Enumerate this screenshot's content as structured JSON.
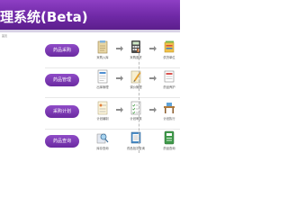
{
  "app": {
    "title": "理系统(Beta)"
  },
  "breadcrumb": "首页",
  "flows": [
    {
      "category": "药品采购",
      "items": [
        "采购入库",
        "采购退货",
        "供货单位"
      ]
    },
    {
      "category": "药品管理",
      "items": [
        "出库管理",
        "调价管理",
        "药品养护"
      ]
    },
    {
      "category": "采购计划",
      "items": [
        "计划编制",
        "计划审核",
        "计划执行"
      ]
    },
    {
      "category": "药品查询",
      "items": [
        "库存查询",
        "药品批次查询",
        "药品查询"
      ]
    }
  ],
  "colors": {
    "header": "#6f29a6",
    "category_button": "#7a36b0"
  },
  "icons": [
    [
      "clipboard-icon",
      "calculator-icon",
      "folder-stack-icon"
    ],
    [
      "document-icon",
      "pencil-note-icon",
      "receipt-icon"
    ],
    [
      "plan-document-icon",
      "checklist-icon",
      "desk-icon"
    ],
    [
      "magnifier-icon",
      "ledger-icon",
      "book-icon"
    ]
  ]
}
